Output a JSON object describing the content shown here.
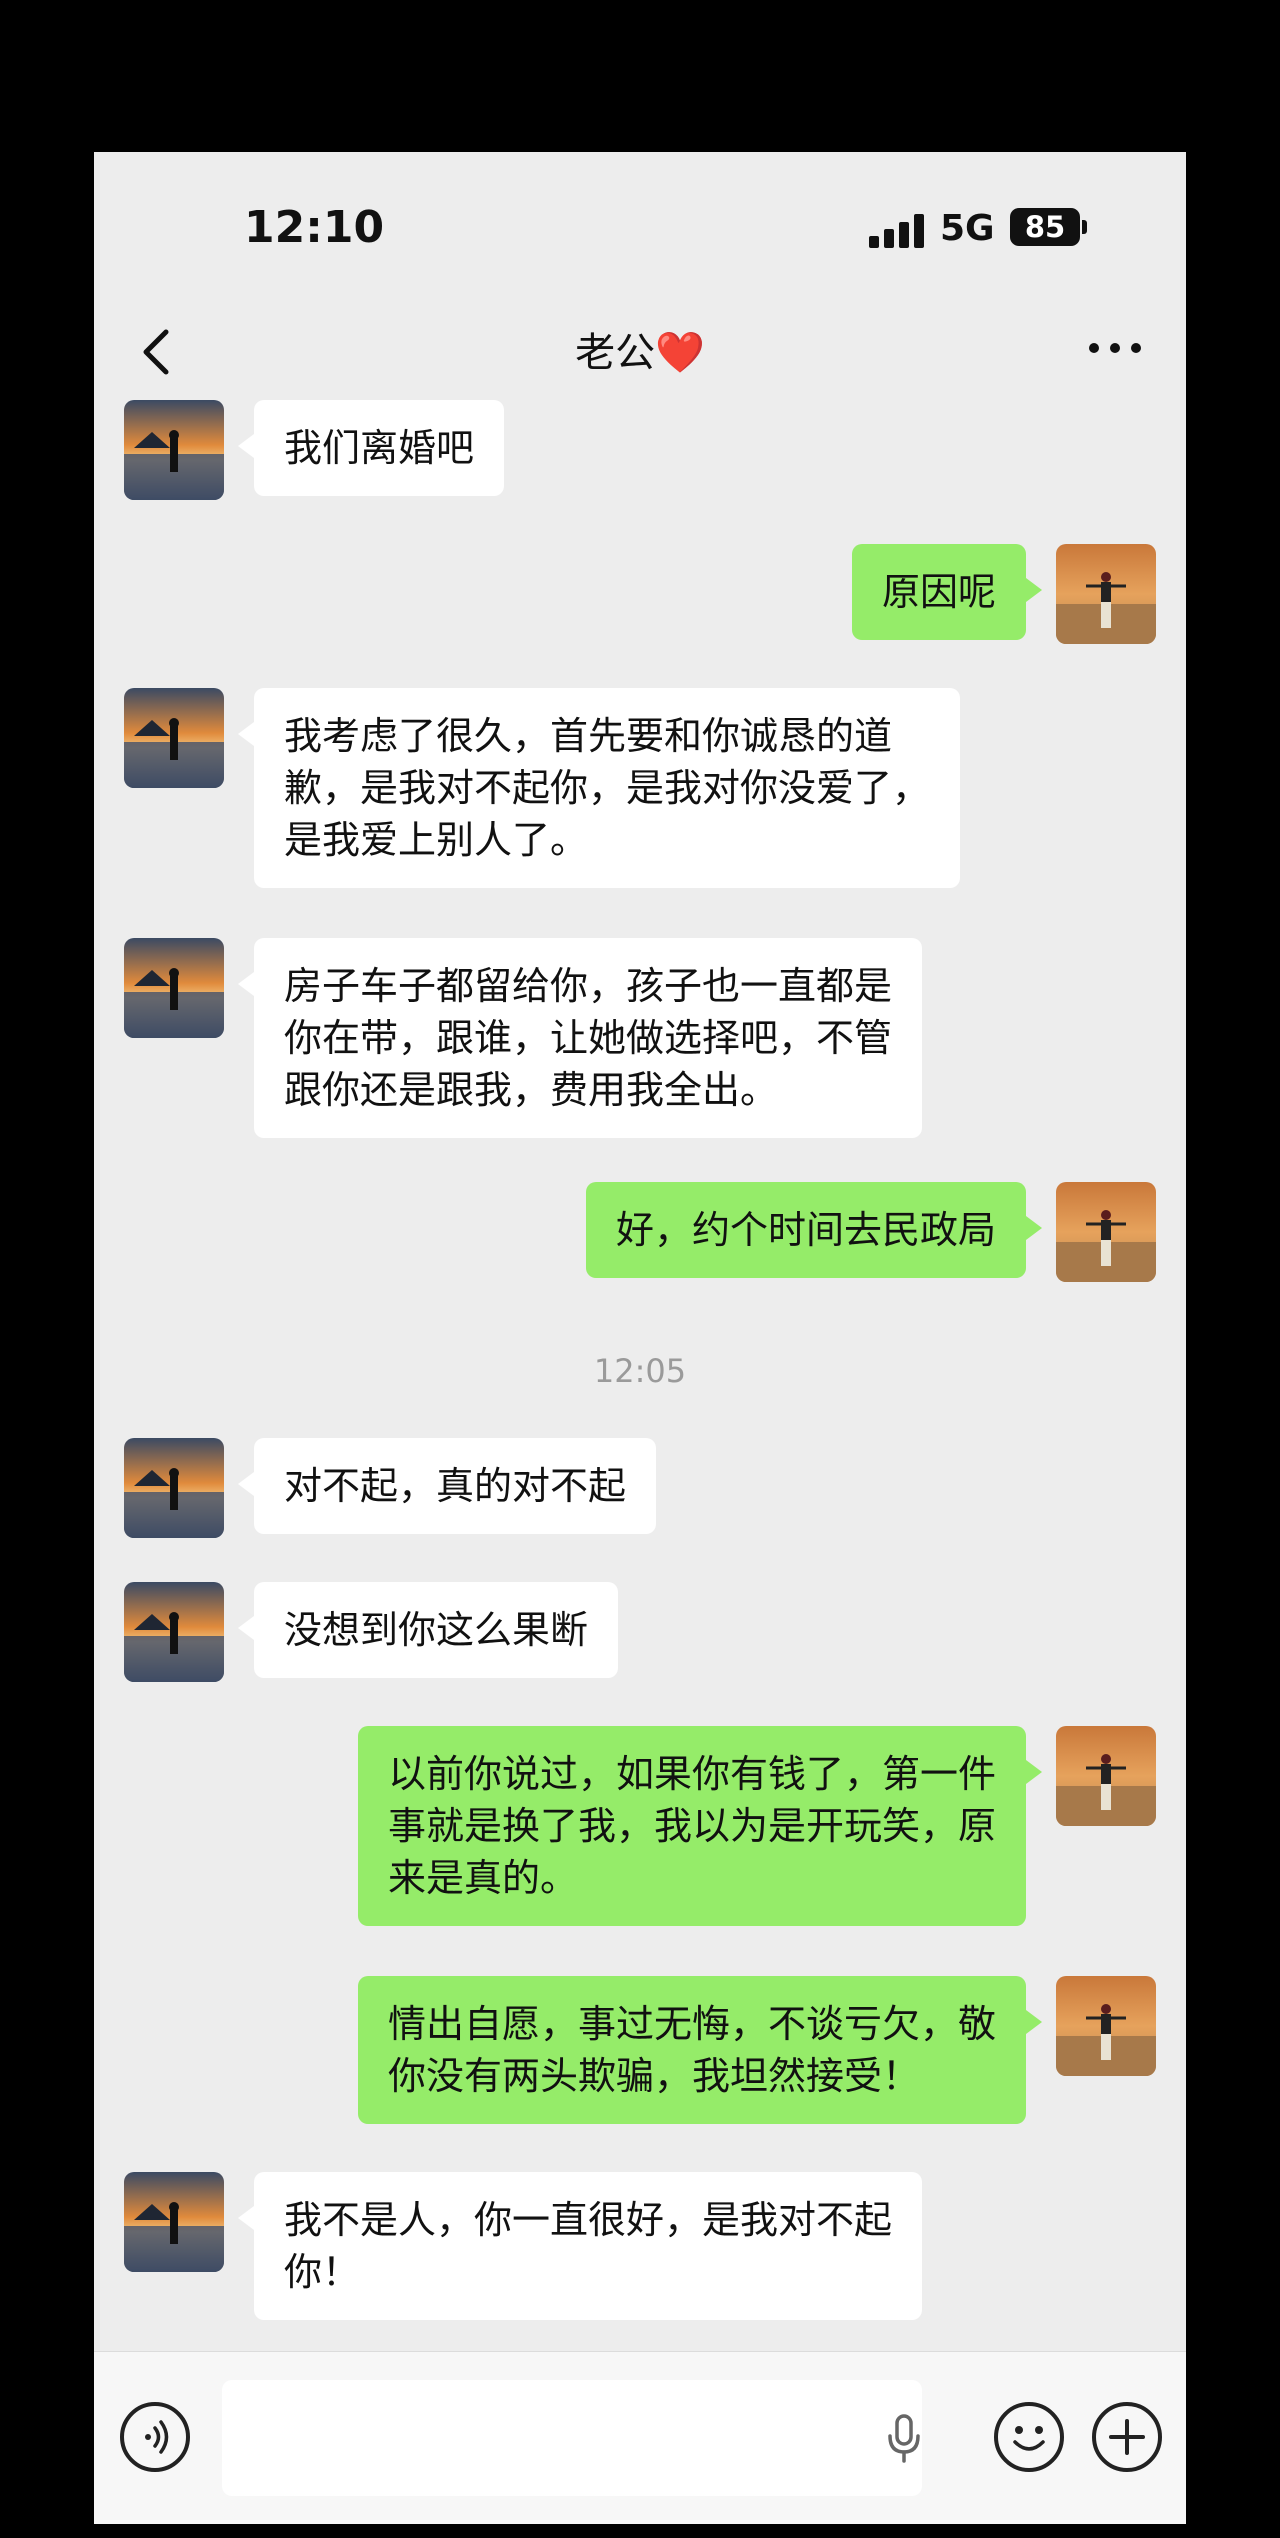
{
  "status_bar": {
    "time": "12:10",
    "network": "5G",
    "battery": "85"
  },
  "nav": {
    "title": "老公❤️"
  },
  "timestamp": "12:05",
  "messages": [
    {
      "from": "other",
      "text": "我们离婚吧"
    },
    {
      "from": "me",
      "text": "原因呢"
    },
    {
      "from": "other",
      "text": "我考虑了很久，首先要和你诚恳的道\n歉，是我对不起你，是我对你没爱了，\n是我爱上别人了。"
    },
    {
      "from": "other",
      "text": "房子车子都留给你，孩子也一直都是\n你在带，跟谁，让她做选择吧，不管\n跟你还是跟我，费用我全出。"
    },
    {
      "from": "me",
      "text": "好，约个时间去民政局"
    },
    {
      "from": "other",
      "text": "对不起，真的对不起"
    },
    {
      "from": "other",
      "text": "没想到你这么果断"
    },
    {
      "from": "me",
      "text": "以前你说过，如果你有钱了，第一件\n事就是换了我，我以为是开玩笑，原\n来是真的。"
    },
    {
      "from": "me",
      "text": "情出自愿，事过无悔，不谈亏欠，敬\n你没有两头欺骗，我坦然接受！"
    },
    {
      "from": "other",
      "text": "我不是人，你一直很好，是我对不起\n你！"
    }
  ]
}
